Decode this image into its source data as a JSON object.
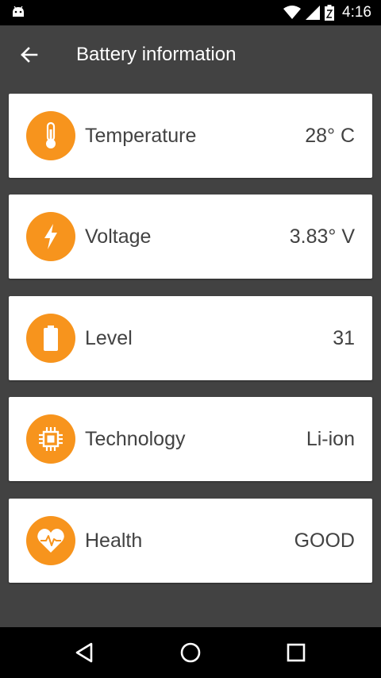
{
  "status_bar": {
    "time": "4:16",
    "icons": [
      "android-icon",
      "wifi-icon",
      "signal-icon",
      "battery-icon"
    ]
  },
  "app_bar": {
    "title": "Battery information",
    "back_icon": "arrow-left-icon"
  },
  "colors": {
    "accent": "#f7941d",
    "background": "#424242",
    "card": "#ffffff",
    "text": "#424242"
  },
  "cards": [
    {
      "icon": "thermometer-icon",
      "label": "Temperature",
      "value": "28° C"
    },
    {
      "icon": "lightning-icon",
      "label": "Voltage",
      "value": "3.83° V"
    },
    {
      "icon": "battery-icon",
      "label": "Level",
      "value": "31"
    },
    {
      "icon": "chip-icon",
      "label": "Technology",
      "value": "Li-ion"
    },
    {
      "icon": "heart-pulse-icon",
      "label": "Health",
      "value": "GOOD"
    }
  ],
  "nav_bar": {
    "buttons": [
      "back-triangle-icon",
      "home-circle-icon",
      "recents-square-icon"
    ]
  }
}
